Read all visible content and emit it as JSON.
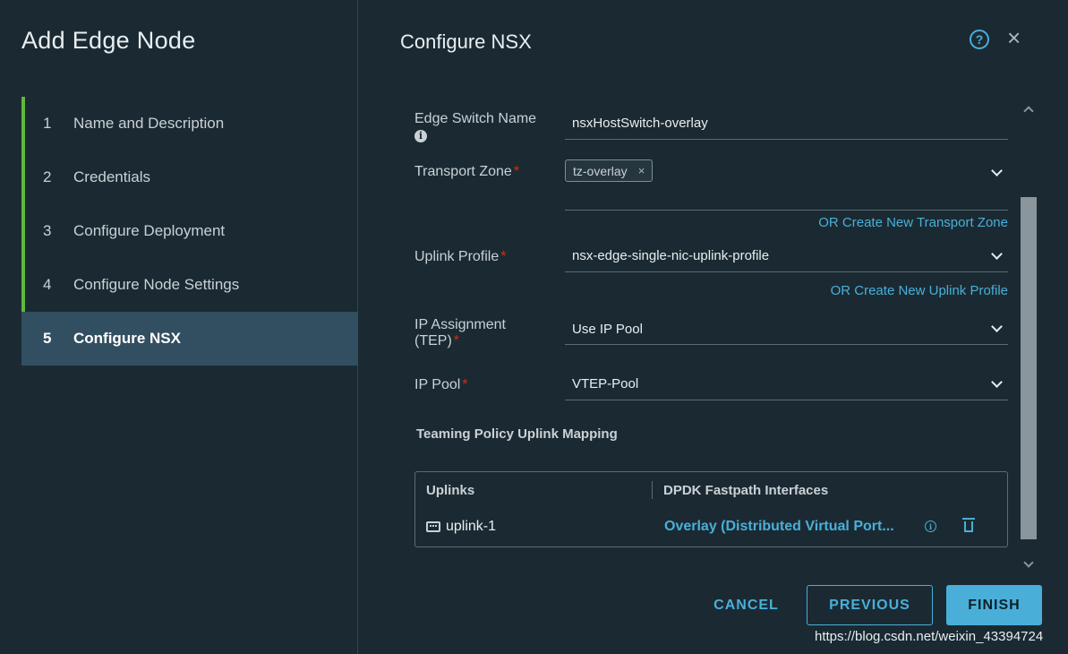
{
  "wizard": {
    "title": "Add Edge Node",
    "steps": [
      {
        "num": "1",
        "label": "Name and Description"
      },
      {
        "num": "2",
        "label": "Credentials"
      },
      {
        "num": "3",
        "label": "Configure Deployment"
      },
      {
        "num": "4",
        "label": "Configure Node Settings"
      },
      {
        "num": "5",
        "label": "Configure NSX"
      }
    ]
  },
  "header": {
    "title": "Configure NSX",
    "help_icon": "?",
    "close_icon": "×"
  },
  "form": {
    "edge_switch_name": {
      "label": "Edge Switch Name",
      "value": "nsxHostSwitch-overlay"
    },
    "transport_zone": {
      "label": "Transport Zone",
      "tag": "tz-overlay",
      "tag_remove": "×",
      "link": "OR Create New Transport Zone"
    },
    "uplink_profile": {
      "label": "Uplink Profile",
      "value": "nsx-edge-single-nic-uplink-profile",
      "link": "OR Create New Uplink Profile"
    },
    "ip_assignment": {
      "label_line1": "IP Assignment",
      "label_line2": "(TEP)",
      "value": "Use IP Pool"
    },
    "ip_pool": {
      "label": "IP Pool",
      "value": "VTEP-Pool"
    },
    "required_mark": "*",
    "info_glyph": "i"
  },
  "teaming": {
    "title": "Teaming Policy Uplink Mapping",
    "col_uplinks": "Uplinks",
    "col_dpdk": "DPDK Fastpath Interfaces",
    "rows": [
      {
        "uplink": "uplink-1",
        "interface": "Overlay (Distributed Virtual Port..."
      }
    ]
  },
  "buttons": {
    "cancel": "CANCEL",
    "previous": "PREVIOUS",
    "finish": "FINISH"
  },
  "watermark": "https://blog.csdn.net/weixin_43394724",
  "colors": {
    "accent": "#49afd9",
    "step_done": "#5fb83a",
    "required": "#e62700",
    "background": "#1b2a32"
  }
}
